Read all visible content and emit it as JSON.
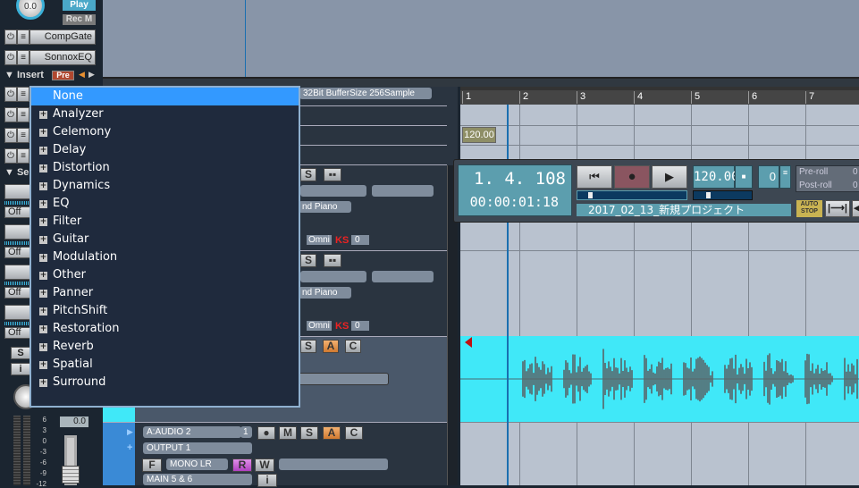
{
  "mixer": {
    "pan_value": "0.0",
    "play_label": "Play",
    "rec_label": "Rec M",
    "effects": [
      "CompGate",
      "SonnoxEQ"
    ],
    "insert_label": "▼ Insert",
    "pre_label": "Pre",
    "send_label": "▼ Se",
    "off_label": "Off",
    "solo_label": "S",
    "info_label": "i",
    "fader_value": "0.0",
    "meter_scale": [
      "6",
      "3",
      "0",
      "-3",
      "-6",
      "-9",
      "-12"
    ]
  },
  "insert_menu": {
    "items": [
      {
        "label": "None",
        "selected": true,
        "expandable": false
      },
      {
        "label": "Analyzer",
        "expandable": true
      },
      {
        "label": "Celemony",
        "expandable": true
      },
      {
        "label": "Delay",
        "expandable": true
      },
      {
        "label": "Distortion",
        "expandable": true
      },
      {
        "label": "Dynamics",
        "expandable": true
      },
      {
        "label": "EQ",
        "expandable": true
      },
      {
        "label": "Filter",
        "expandable": true
      },
      {
        "label": "Guitar",
        "expandable": true
      },
      {
        "label": "Modulation",
        "expandable": true
      },
      {
        "label": "Other",
        "expandable": true
      },
      {
        "label": "Panner",
        "expandable": true
      },
      {
        "label": "PitchShift",
        "expandable": true
      },
      {
        "label": "Restoration",
        "expandable": true
      },
      {
        "label": "Reverb",
        "expandable": true
      },
      {
        "label": "Spatial",
        "expandable": true
      },
      {
        "label": "Surround",
        "expandable": true
      }
    ]
  },
  "tracks": {
    "buffer_info": "32Bit BufferSize 256Sample",
    "midi1": {
      "solo": "S",
      "instrument": "nd Piano",
      "omni": "Omni",
      "ks": "KS",
      "ks_value": "0"
    },
    "midi2": {
      "solo": "S",
      "instrument": "nd Piano",
      "omni": "Omni",
      "ks": "KS",
      "ks_value": "0"
    },
    "audio1": {
      "solo": "S",
      "a": "A",
      "c": "C"
    },
    "audio2": {
      "name": "A:AUDIO 2",
      "channel": "1",
      "mute": "M",
      "solo": "S",
      "a": "A",
      "c": "C",
      "output": "OUTPUT 1",
      "f": "F",
      "mode": "MONO LR",
      "r": "R",
      "w": "W",
      "bus": "MAIN 5 & 6",
      "info": "i"
    }
  },
  "timeline": {
    "measures": [
      "1",
      "2",
      "3",
      "4",
      "5",
      "6",
      "7"
    ],
    "tempo_marker": "120.00"
  },
  "transport": {
    "position": "1. 4. 108",
    "time": "00:00:01:18",
    "tempo": "120.00",
    "tempo_btn": "■",
    "count": "0",
    "pre_roll_label": "Pre-roll",
    "pre_roll_value": "0",
    "post_roll_label": "Post-roll",
    "post_roll_value": "0",
    "project_name": "2017_02_13_新規プロジェクト",
    "auto_stop": "AUTO STOP"
  },
  "colors": {
    "menu_highlight": "#3399ff",
    "clip": "#40e8f8",
    "playhead": "#1a6fb0",
    "record": "#8a5560"
  }
}
